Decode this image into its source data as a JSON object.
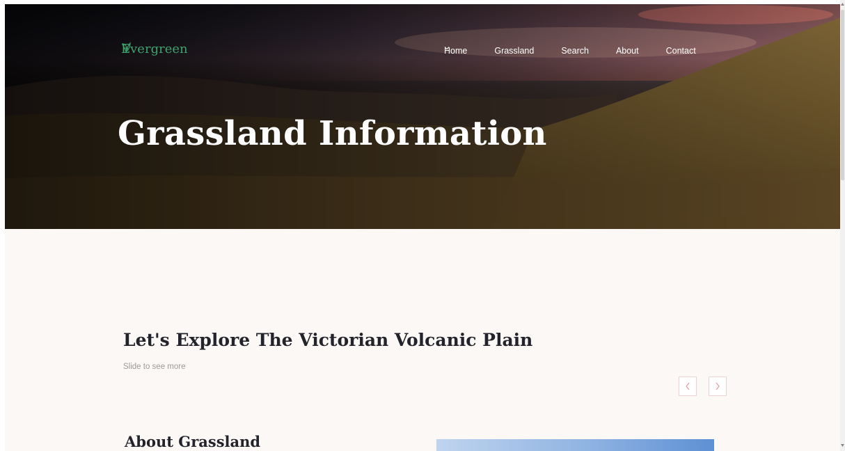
{
  "brand": {
    "name": "Evergreen",
    "icon": "leaf-icon",
    "color": "#3fa36e"
  },
  "nav": {
    "items": [
      {
        "label": "Home"
      },
      {
        "label": "Grassland"
      },
      {
        "label": "Search",
        "has_dropdown": true
      },
      {
        "label": "About"
      },
      {
        "label": "Contact"
      }
    ]
  },
  "hero": {
    "title": "Grassland Information"
  },
  "explore": {
    "title": "Let's Explore The Victorian Volcanic Plain",
    "subtitle": "Slide to see more",
    "prev_icon": "chevron-left-icon",
    "next_icon": "chevron-right-icon",
    "accent_color": "#e49a9a"
  },
  "about": {
    "title": "About Grassland"
  }
}
